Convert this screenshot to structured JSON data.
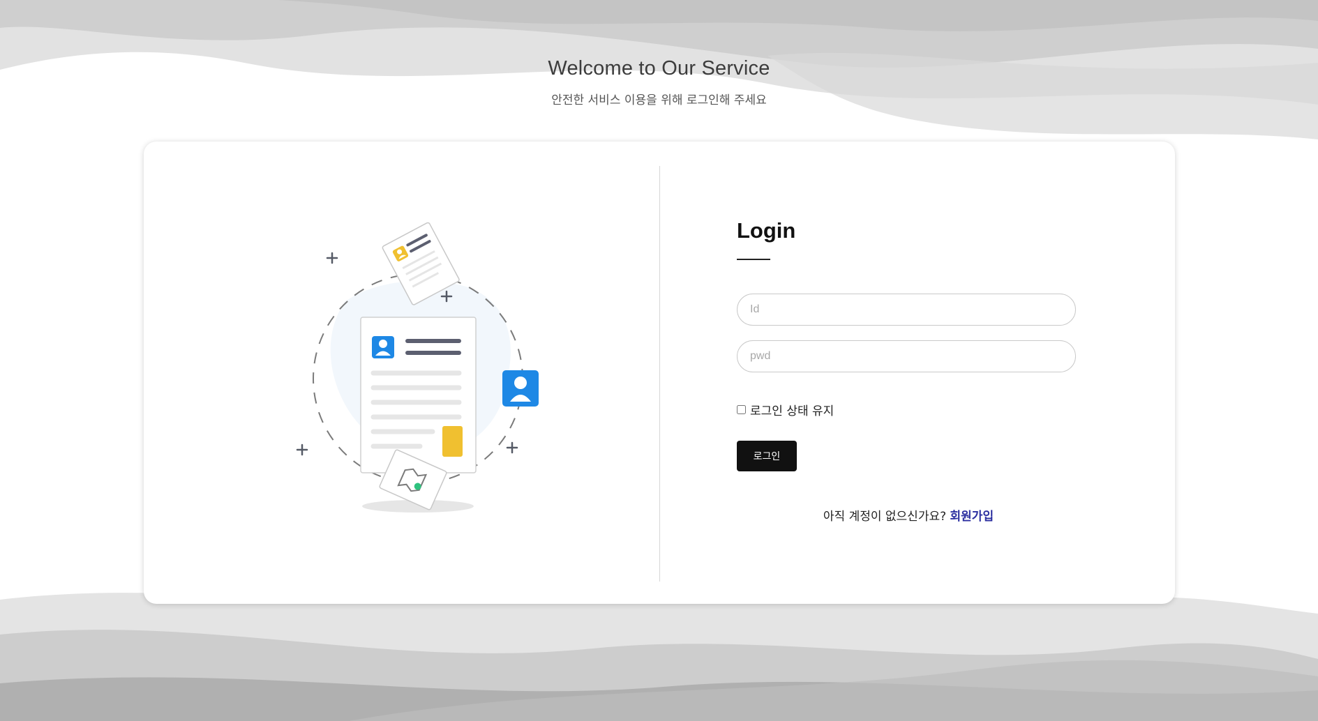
{
  "hero": {
    "title": "Welcome to Our Service",
    "subtitle": "안전한 서비스 이용을 위해 로그인해 주세요"
  },
  "illustration": {
    "icon": "profile-documents-illustration",
    "colors": {
      "accent_blue": "#1e88e5",
      "accent_yellow": "#f0c030",
      "accent_green": "#2ec27e"
    }
  },
  "login": {
    "title": "Login",
    "id_placeholder": "Id",
    "pwd_placeholder": "pwd",
    "remember_label": "로그인 상태 유지",
    "submit_label": "로그인",
    "signup_prompt": "아직 계정이 없으신가요?",
    "signup_link": "회원가입"
  },
  "colors": {
    "button_bg": "#111111",
    "link": "#2b2fa0"
  }
}
